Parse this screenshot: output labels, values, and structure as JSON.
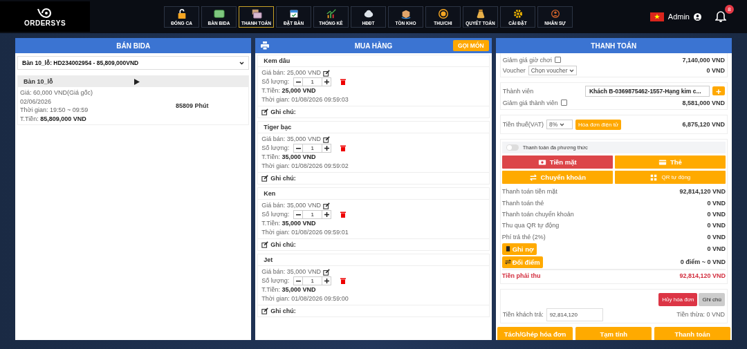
{
  "header": {
    "logo": "ORDERSYS",
    "user": "Admin",
    "notifications": "8",
    "nav": [
      {
        "label": "ĐÓNG CA",
        "selected": false
      },
      {
        "label": "BÀN BIDA",
        "selected": false
      },
      {
        "label": "THANH TOÁN",
        "selected": true
      },
      {
        "label": "ĐẶT BÀN",
        "selected": false
      },
      {
        "label": "THỐNG KÊ",
        "selected": false
      },
      {
        "label": "HĐĐT",
        "selected": false
      },
      {
        "label": "TỒN KHO",
        "selected": false
      },
      {
        "label": "THU/CHI",
        "selected": false
      },
      {
        "label": "QUYẾT TOÁN",
        "selected": false
      },
      {
        "label": "CÀI ĐẶT",
        "selected": false
      },
      {
        "label": "NHÂN SỰ",
        "selected": false
      }
    ]
  },
  "billiards": {
    "title": "BÁN BIDA",
    "bill_select": "Bàn 10_lỗ: HD234002954 - 85,809,000VND",
    "table": {
      "name": "Bàn 10_lỗ",
      "lines": [
        "Giá: 60,000 VND(Giá gốc)",
        "02/06/2026",
        "Thời gian: 19:50 ~ 09:59",
        "T.Tiền: **85,809,000 VND**"
      ],
      "duration": "85809 Phút"
    }
  },
  "purchases": {
    "title": "MUA HÀNG",
    "order_button": "GỌI MÓN",
    "items": [
      {
        "name": "Kem dâu",
        "price": "Giá bán: 25,000 VND",
        "quantity_label": "Số lượng:",
        "quantity": "1",
        "total": "T.Tiền: **25,000 VND**",
        "time": "Thời gian: 01/08/2026 09:59:03",
        "note": "Ghi chú:"
      },
      {
        "name": "Tiger bạc",
        "price": "Giá bán: 35,000 VND",
        "quantity_label": "Số lượng:",
        "quantity": "1",
        "total": "T.Tiền: **35,000 VND**",
        "time": "Thời gian: 01/08/2026 09:59:02",
        "note": "Ghi chú:"
      },
      {
        "name": "Ken",
        "price": "Giá bán: 35,000 VND",
        "quantity_label": "Số lượng:",
        "quantity": "1",
        "total": "T.Tiền: **35,000 VND**",
        "time": "Thời gian: 01/08/2026 09:59:01",
        "note": "Ghi chú:"
      },
      {
        "name": "Jet",
        "price": "Giá bán: 35,000 VND",
        "quantity_label": "Số lượng:",
        "quantity": "1",
        "total": "T.Tiền: **35,000 VND**",
        "time": "Thời gian: 01/08/2026 09:59:00",
        "note": "Ghi chú:"
      }
    ]
  },
  "payment": {
    "title": "THANH TOÁN",
    "hour_discount": {
      "label": "Giảm giá giờ chơi",
      "checked": false,
      "value": "7,140,000 VND"
    },
    "voucher": {
      "label": "Voucher",
      "select": "Chọn voucher",
      "value": "0 VND"
    },
    "member": {
      "label": "Thành viên",
      "select": "Khách B-0369875462-1557-Hạng kim c...",
      "add": "+"
    },
    "member_discount": {
      "label": "Giảm giá thành viên",
      "checked": false,
      "value": "8,581,000 VND"
    },
    "vat": {
      "label": "Tiền thuế(VAT)",
      "select": "8%",
      "button": "Hóa đơn điện tử",
      "value": "6,875,120 VND"
    },
    "multi_method": {
      "label": "Thanh toán đa phương thức",
      "on": false
    },
    "methods": [
      {
        "label": "Tiền mặt",
        "selected": true
      },
      {
        "label": "Thẻ",
        "selected": false
      },
      {
        "label": "Chuyển khoản",
        "selected": false
      },
      {
        "label": "QR tự động",
        "selected": false
      }
    ],
    "summary": [
      {
        "kind": "text",
        "label": "Thanh toán tiền mặt",
        "value": "92,814,120 VND"
      },
      {
        "kind": "text",
        "label": "Thanh toán thẻ",
        "value": "0 VND"
      },
      {
        "kind": "text",
        "label": "Thanh toán chuyển khoản",
        "value": "0 VND"
      },
      {
        "kind": "text",
        "label": "Thu qua QR tự động",
        "value": "0 VND"
      },
      {
        "kind": "text",
        "label": "Phí trả thẻ (2%)",
        "value": "0 VND"
      },
      {
        "kind": "debt",
        "label": "Ghi nợ",
        "value": "0 VND"
      },
      {
        "kind": "points",
        "label": "Đổi điểm",
        "value": "0 điểm ~ 0 VND"
      }
    ],
    "due": {
      "label": "Tiền phải thu",
      "value": "92,814,120 VND"
    },
    "cancel_button": "Hủy hóa đơn",
    "note_button": "Ghi chú",
    "paid": {
      "label": "Tiền khách trả:",
      "value": "92,814,120"
    },
    "change": "Tiền thừa: 0 VND",
    "actions": [
      "Tách/Ghép hóa đơn",
      "Tạm tính",
      "Thanh toán"
    ]
  }
}
